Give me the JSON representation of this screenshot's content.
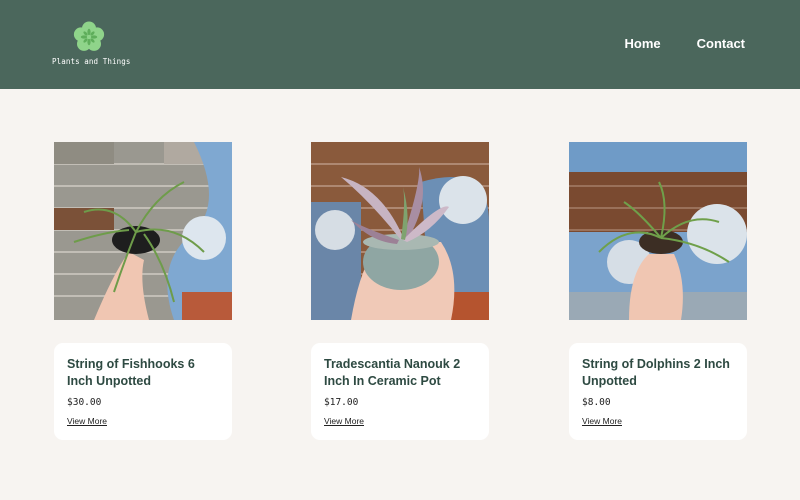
{
  "brand": {
    "name": "Plants and Things",
    "logo_icon": "succulent-flower-icon"
  },
  "nav": {
    "items": [
      {
        "label": "Home"
      },
      {
        "label": "Contact"
      }
    ]
  },
  "products": [
    {
      "name": "String of Fishhooks 6 Inch Unpotted",
      "price": "$30.00",
      "link_label": "View More"
    },
    {
      "name": "Tradescantia Nanouk 2 Inch In Ceramic Pot",
      "price": "$17.00",
      "link_label": "View More"
    },
    {
      "name": "String of Dolphins 2 Inch Unpotted",
      "price": "$8.00",
      "link_label": "View More"
    }
  ],
  "colors": {
    "header": "#4b675c",
    "page_background": "#f7f4f1",
    "card_background": "#ffffff",
    "title_text": "#2e4a42",
    "logo_green": "#8fd48a"
  }
}
